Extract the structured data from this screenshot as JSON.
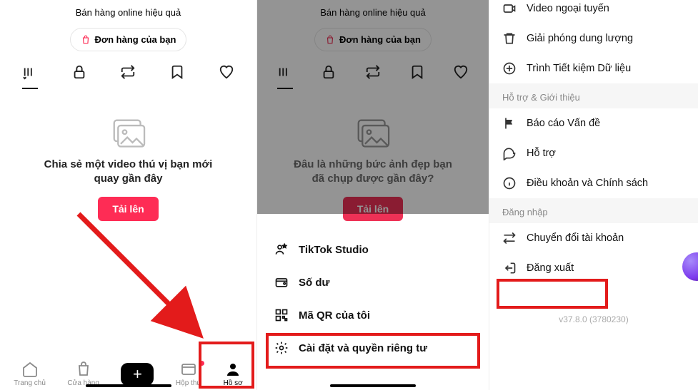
{
  "panel1": {
    "tagline": "Bán hàng online hiệu quả",
    "order_button": "Đơn hàng của bạn",
    "empty_title_l1": "Chia sẻ một video thú vị bạn mới",
    "empty_title_l2": "quay gần đây",
    "upload": "Tải lên",
    "nav": {
      "home": "Trang chủ",
      "shop": "Cửa hàng",
      "inbox": "Hộp thư",
      "profile": "Hồ sơ"
    }
  },
  "panel2": {
    "tagline": "Bán hàng online hiệu quả",
    "order_button": "Đơn hàng của bạn",
    "empty_title_l1": "Đâu là những bức ảnh đẹp bạn",
    "empty_title_l2": "đã chụp được gần đây?",
    "upload": "Tải lên",
    "sheet": {
      "studio": "TikTok Studio",
      "balance": "Số dư",
      "qr": "Mã QR của tôi",
      "settings": "Cài đặt và quyền riêng tư"
    }
  },
  "panel3": {
    "offline_video": "Video ngoại tuyến",
    "free_space": "Giải phóng dung lượng",
    "data_saver": "Trình Tiết kiệm Dữ liệu",
    "section_support": "Hỗ trợ & Giới thiệu",
    "report": "Báo cáo Vấn đề",
    "support": "Hỗ trợ",
    "terms": "Điều khoản và Chính sách",
    "section_login": "Đăng nhập",
    "switch_account": "Chuyển đổi tài khoản",
    "logout": "Đăng xuất",
    "version": "v37.8.0 (3780230)"
  }
}
